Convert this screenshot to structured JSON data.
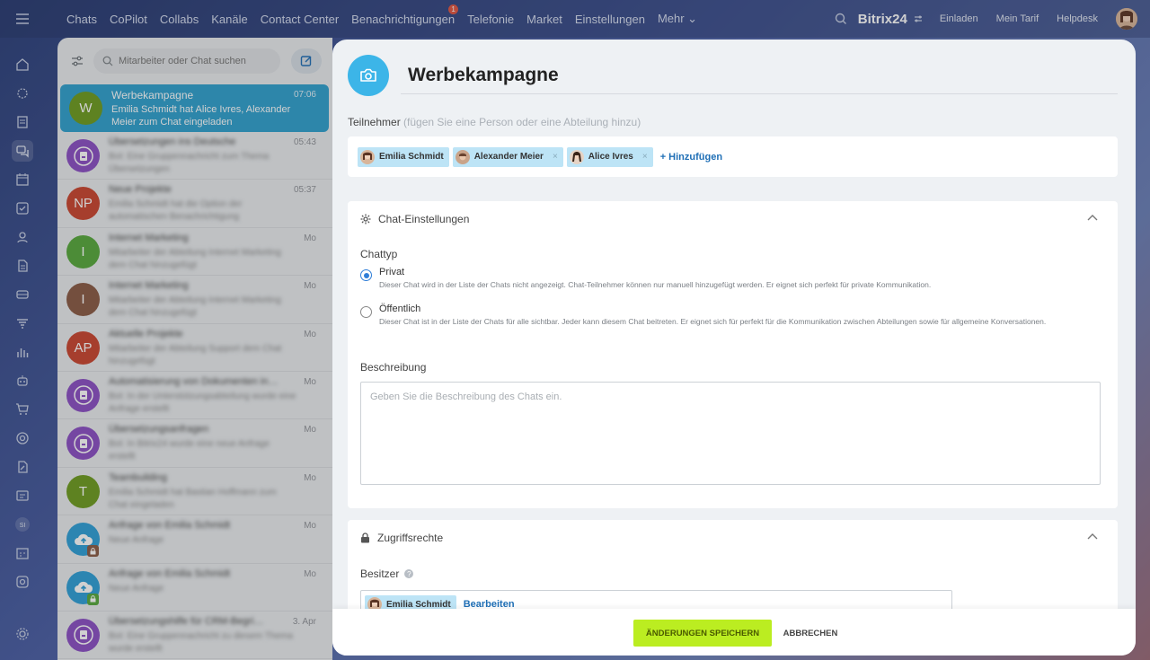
{
  "topbar": {
    "nav": [
      {
        "label": "Chats"
      },
      {
        "label": "CoPilot"
      },
      {
        "label": "Collabs"
      },
      {
        "label": "Kanäle"
      },
      {
        "label": "Contact Center"
      },
      {
        "label": "Benachrichtigungen",
        "badge": "1"
      },
      {
        "label": "Telefonie"
      },
      {
        "label": "Market"
      },
      {
        "label": "Einstellungen"
      },
      {
        "label": "Mehr ⌄"
      }
    ],
    "logo": "Bitrix24",
    "links": [
      "Einladen",
      "Mein Tarif",
      "Helpdesk"
    ]
  },
  "leftnav": {
    "user_initials": "SI"
  },
  "chatlist": {
    "search_placeholder": "Mitarbeiter oder Chat suchen",
    "items": [
      {
        "name": "Werbekampagne",
        "time": "07:06",
        "preview": "Emilia Schmidt hat Alice Ivres, Alexander Meier zum Chat eingeladen",
        "initials": "W",
        "color": "#6d9b1f",
        "active": true
      },
      {
        "name": "Übersetzungen ins Deutsche",
        "time": "05:43",
        "preview": "Bot: Eine Gruppennachricht zum Thema Übersetzungen",
        "initials": "",
        "color": "#8b4fc4"
      },
      {
        "name": "Neue Projekte",
        "time": "05:37",
        "preview": "Emilia Schmidt hat die Option der automatischen Benachrichtigung",
        "initials": "NP",
        "color": "#c9452f"
      },
      {
        "name": "Internet Marketing",
        "time": "Mo",
        "preview": "Mitarbeiter der Abteilung Internet Marketing dem Chat hinzugefügt",
        "initials": "I",
        "color": "#56a83b"
      },
      {
        "name": "Internet Marketing",
        "time": "Mo",
        "preview": "Mitarbeiter der Abteilung Internet Marketing dem Chat hinzugefügt",
        "initials": "I",
        "color": "#8a5a44"
      },
      {
        "name": "Aktuelle Projekte",
        "time": "Mo",
        "preview": "Mitarbeiter der Abteilung Support dem Chat hinzugefügt",
        "initials": "AP",
        "color": "#c9452f"
      },
      {
        "name": "Automatisierung von Dokumenten in…",
        "time": "Mo",
        "preview": "Bot: In der Unterstützungsabteilung wurde eine Anfrage erstellt",
        "initials": "",
        "color": "#8b4fc4"
      },
      {
        "name": "Übersetzungsanfragen",
        "time": "Mo",
        "preview": "Bot: In Bitrix24 wurde eine neue Anfrage erstellt",
        "initials": "",
        "color": "#8b4fc4"
      },
      {
        "name": "Teambuilding",
        "time": "Mo",
        "preview": "Emilia Schmidt hat Bastian Hoffmann zum Chat eingeladen",
        "initials": "T",
        "color": "#6d9b1f"
      },
      {
        "name": "Anfrage von Emilia Schmidt",
        "time": "Mo",
        "preview": "Neue Anfrage",
        "initials": "",
        "color": "#2d9fd8",
        "lock": "#8a5a44"
      },
      {
        "name": "Anfrage von Emilia Schmidt",
        "time": "Mo",
        "preview": "Neue Anfrage",
        "initials": "",
        "color": "#2d9fd8",
        "lock": "#56a83b"
      },
      {
        "name": "Übersetzungshilfe für CRM-Begri…",
        "time": "3. Apr",
        "preview": "Bot: Eine Gruppennachricht zu diesem Thema wurde erstellt",
        "initials": "",
        "color": "#8b4fc4"
      }
    ]
  },
  "slider": {
    "title": "Werbekampagne",
    "participants_label": "Teilnehmer",
    "participants_hint": "(fügen Sie eine Person oder eine Abteilung hinzu)",
    "participants": [
      {
        "name": "Emilia Schmidt",
        "removable": false
      },
      {
        "name": "Alexander Meier",
        "removable": true
      },
      {
        "name": "Alice Ivres",
        "removable": true
      }
    ],
    "add_label": "+ Hinzufügen",
    "settings": {
      "title": "Chat-Einstellungen",
      "chattype_label": "Chattyp",
      "options": [
        {
          "label": "Privat",
          "desc": "Dieser Chat wird in der Liste der Chats nicht angezeigt. Chat-Teilnehmer können nur manuell hinzugefügt werden. Er eignet sich perfekt für private Kommunikation.",
          "selected": true
        },
        {
          "label": "Öffentlich",
          "desc": "Dieser Chat ist in der Liste der Chats für alle sichtbar. Jeder kann diesem Chat beitreten. Er eignet sich für perfekt für die Kommunikation zwischen Abteilungen sowie für allgemeine Konversationen.",
          "selected": false
        }
      ],
      "description_label": "Beschreibung",
      "description_placeholder": "Geben Sie die Beschreibung des Chats ein.",
      "description_value": ""
    },
    "access": {
      "title": "Zugriffsrechte",
      "owner_label": "Besitzer",
      "help": "?",
      "owner": "Emilia Schmidt",
      "edit_label": "Bearbeiten"
    },
    "footer": {
      "save": "ÄNDERUNGEN SPEICHERN",
      "cancel": "ABBRECHEN"
    }
  },
  "colors": {
    "accent": "#2fa0cf",
    "save": "#bbed21",
    "link": "#1f6fb6"
  }
}
